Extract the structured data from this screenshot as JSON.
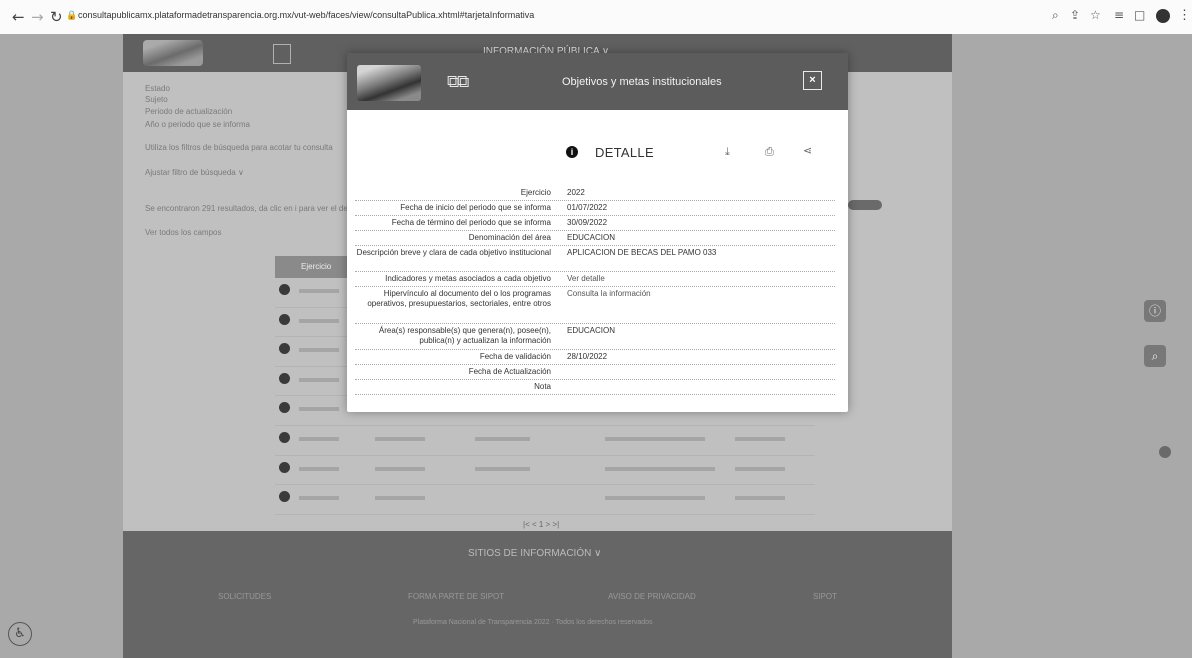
{
  "browser": {
    "url": "consultapublicamx.plataformadetransparencia.org.mx/vut-web/faces/view/consultaPublica.xhtml#tarjetaInformativa"
  },
  "background": {
    "header_text": "INFORMACIÓN PÚBLICA ∨",
    "side_labels": [
      "Estado",
      "Sujeto",
      "Periodo de actualización",
      "Año o periodo que se informa",
      "Utiliza los filtros de búsqueda para acotar tu consulta",
      "Ajustar filtro de búsqueda ∨",
      "Se encontraron 291 resultados, da clic en i para ver el detalle",
      "Ver todos los campos"
    ],
    "table_header": "Ejercicio",
    "pager": "|< < 1 > >|",
    "footer_title": "SITIOS DE INFORMACIÓN ∨",
    "footer_links": [
      "SOLICITUDES",
      "FORMA PARTE DE SIPOT",
      "AVISO DE PRIVACIDAD",
      "SIPOT"
    ],
    "footer_copy": "Plataforma Nacional de Transparencia 2022 · Todos los derechos reservados"
  },
  "modal": {
    "title": "Objetivos y metas institucionales",
    "close_label": "×",
    "detail_title": "DETALLE",
    "rows": [
      {
        "label": "Ejercicio",
        "value": "2022"
      },
      {
        "label": "Fecha de inicio del periodo que se informa",
        "value": "01/07/2022"
      },
      {
        "label": "Fecha de término del periodo que se informa",
        "value": "30/09/2022"
      },
      {
        "label": "Denominación del área",
        "value": "EDUCACION"
      },
      {
        "label": "Descripción breve y clara de cada objetivo institucional",
        "value": "APLICACION DE BECAS DEL PAMO 033"
      },
      {
        "label": "Indicadores y metas asociados a cada objetivo",
        "value": "Ver detalle"
      },
      {
        "label": "Hipervínculo al documento del o los programas operativos, presupuestarios, sectoriales, entre otros",
        "value": "Consulta la información"
      },
      {
        "label": "Área(s) responsable(s) que genera(n), posee(n), publica(n) y actualizan la información",
        "value": "EDUCACION"
      },
      {
        "label": "Fecha de validación",
        "value": "28/10/2022"
      },
      {
        "label": "Fecha de Actualización",
        "value": ""
      },
      {
        "label": "Nota",
        "value": ""
      }
    ]
  }
}
